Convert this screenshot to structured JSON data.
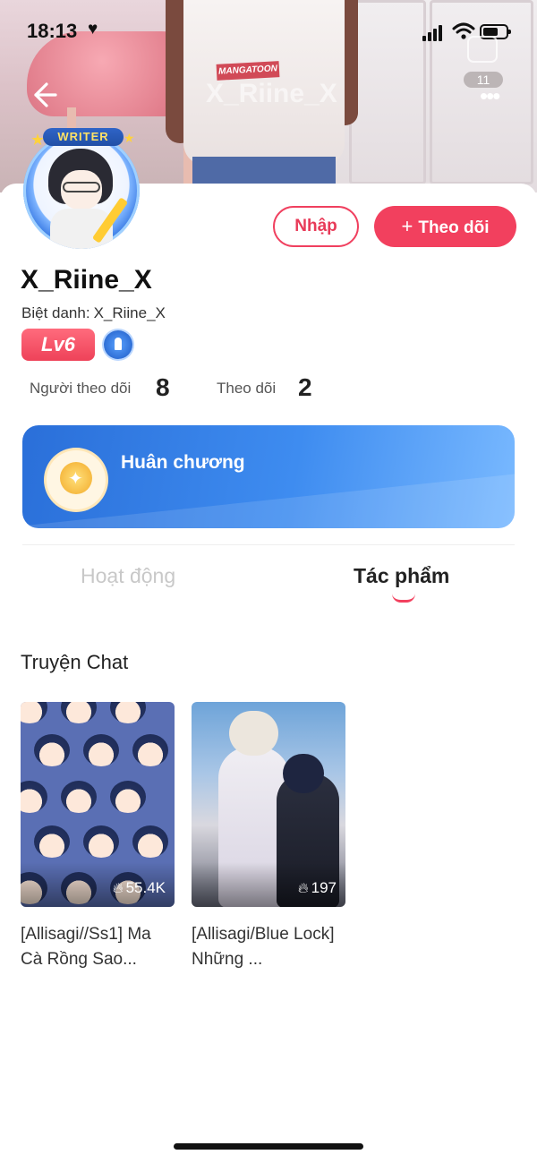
{
  "status_bar": {
    "time": "18:13",
    "heart_icon": "heart-icon"
  },
  "header": {
    "title": "X_Riine_X",
    "count_badge": "11",
    "back_icon": "back-arrow-icon",
    "share_icon": "share-icon",
    "more_icon": "more-dots-icon",
    "shirt_logo": "MANGATOON"
  },
  "profile": {
    "avatar_badge": "WRITER",
    "username": "X_Riine_X",
    "nickname_label": "Biệt danh:",
    "nickname_value": "X_Riine_X",
    "level": "Lv6",
    "buttons": {
      "import_label": "Nhập",
      "follow_label": "Theo dõi",
      "follow_icon": "+"
    },
    "stats": {
      "followers_label": "Người theo dõi",
      "followers_value": "8",
      "following_label": "Theo dõi",
      "following_value": "2"
    }
  },
  "medal": {
    "title": "Huân chương"
  },
  "tabs": {
    "activity_label": "Hoạt động",
    "works_label": "Tác phẩm",
    "active": "works"
  },
  "section": {
    "title": "Truyện Chat"
  },
  "stories": [
    {
      "title": "[Allisagi//Ss1] Ma Cà Rồng Sao...",
      "views": "55.4K"
    },
    {
      "title": "[Allisagi/Blue Lock] Những ...",
      "views": "197"
    }
  ],
  "colors": {
    "accent": "#f2405e",
    "medal_blue": "#2a6fd9",
    "tab_inactive": "#c8c8c8"
  }
}
